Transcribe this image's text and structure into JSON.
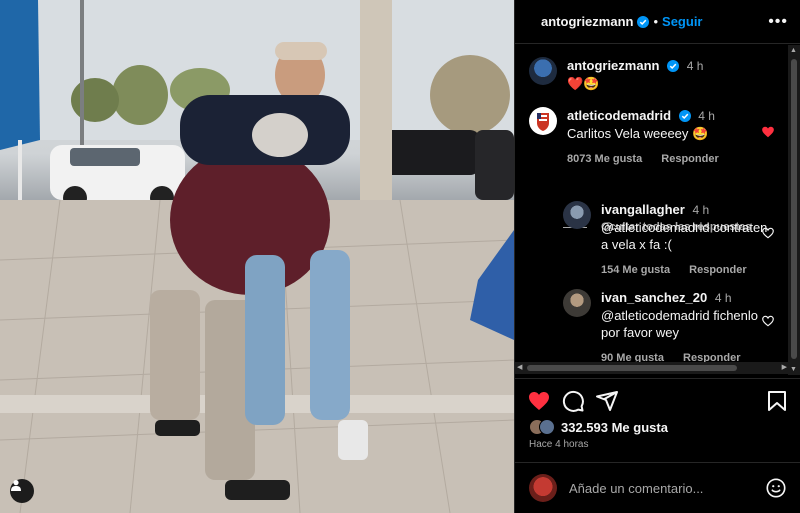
{
  "header": {
    "username": "antogriezmann",
    "separator": "•",
    "follow_label": "Seguir",
    "more_label": "•••"
  },
  "caption": {
    "author": "antogriezmann",
    "time": "4 h",
    "text": "❤️🤩"
  },
  "comments": [
    {
      "author": "atleticodemadrid",
      "time": "4 h",
      "text": "Carlitos Vela weeeey 🤩",
      "likes": "8073 Me gusta",
      "reply_label": "Responder",
      "liked": true
    }
  ],
  "hide_replies_label": "Ocultar todas las respuestas",
  "replies": [
    {
      "author": "ivangallagher",
      "time": "4 h",
      "text_line1": "@atleticodemadrid contraten",
      "text_line2": "a vela x fa :(",
      "likes": "154 Me gusta",
      "reply_label": "Responder"
    },
    {
      "author": "ivan_sanchez_20",
      "time": "4 h",
      "text_line1": "@atleticodemadrid fichenlo",
      "text_line2": "por favor wey",
      "likes": "90 Me gusta",
      "reply_label": "Responder"
    }
  ],
  "post": {
    "like_count": "332.593 Me gusta",
    "posted_ago": "Hace 4 horas",
    "liked": true
  },
  "add_comment": {
    "placeholder": "Añade un comentario..."
  },
  "colors": {
    "accent": "#0095f6",
    "like": "#ff3040",
    "background": "#000000",
    "muted": "#a8a8a8"
  }
}
